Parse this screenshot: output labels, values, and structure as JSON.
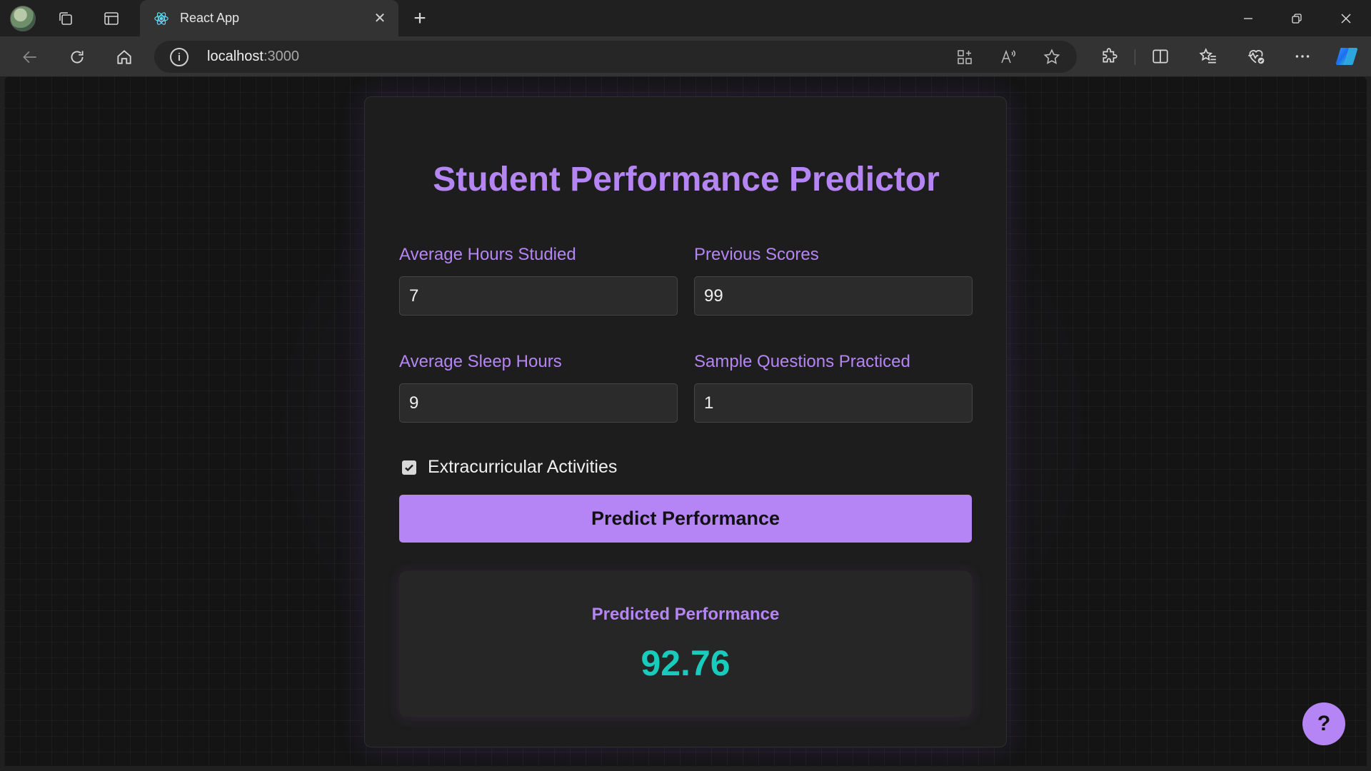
{
  "browser": {
    "tab_title": "React App",
    "url_host": "localhost",
    "url_port": ":3000",
    "icons": [
      "profile-avatar",
      "workspaces-icon",
      "tab-actions-icon",
      "react-favicon",
      "close-icon",
      "new-tab-icon",
      "minimize-icon",
      "restore-icon",
      "window-close-icon",
      "back-icon",
      "refresh-icon",
      "home-icon",
      "site-info-icon",
      "app-available-icon",
      "read-aloud-icon",
      "favorite-star-icon",
      "extensions-icon",
      "split-screen-icon",
      "favorites-icon",
      "browser-essentials-icon",
      "more-icon",
      "copilot-icon"
    ]
  },
  "app": {
    "title": "Student Performance Predictor",
    "fields": [
      {
        "label": "Average Hours Studied",
        "value": "7"
      },
      {
        "label": "Previous Scores",
        "value": "99"
      },
      {
        "label": "Average Sleep Hours",
        "value": "9"
      },
      {
        "label": "Sample Questions Practiced",
        "value": "1"
      }
    ],
    "extracurricular": {
      "label": "Extracurricular Activities",
      "checked": true
    },
    "predict_button": "Predict Performance",
    "result": {
      "label": "Predicted Performance",
      "value": "92.76"
    },
    "help_button": "?"
  },
  "colors": {
    "accent": "#b586f3",
    "result_value": "#18cbbd",
    "background": "#141414",
    "card": "#1d1d1d"
  }
}
